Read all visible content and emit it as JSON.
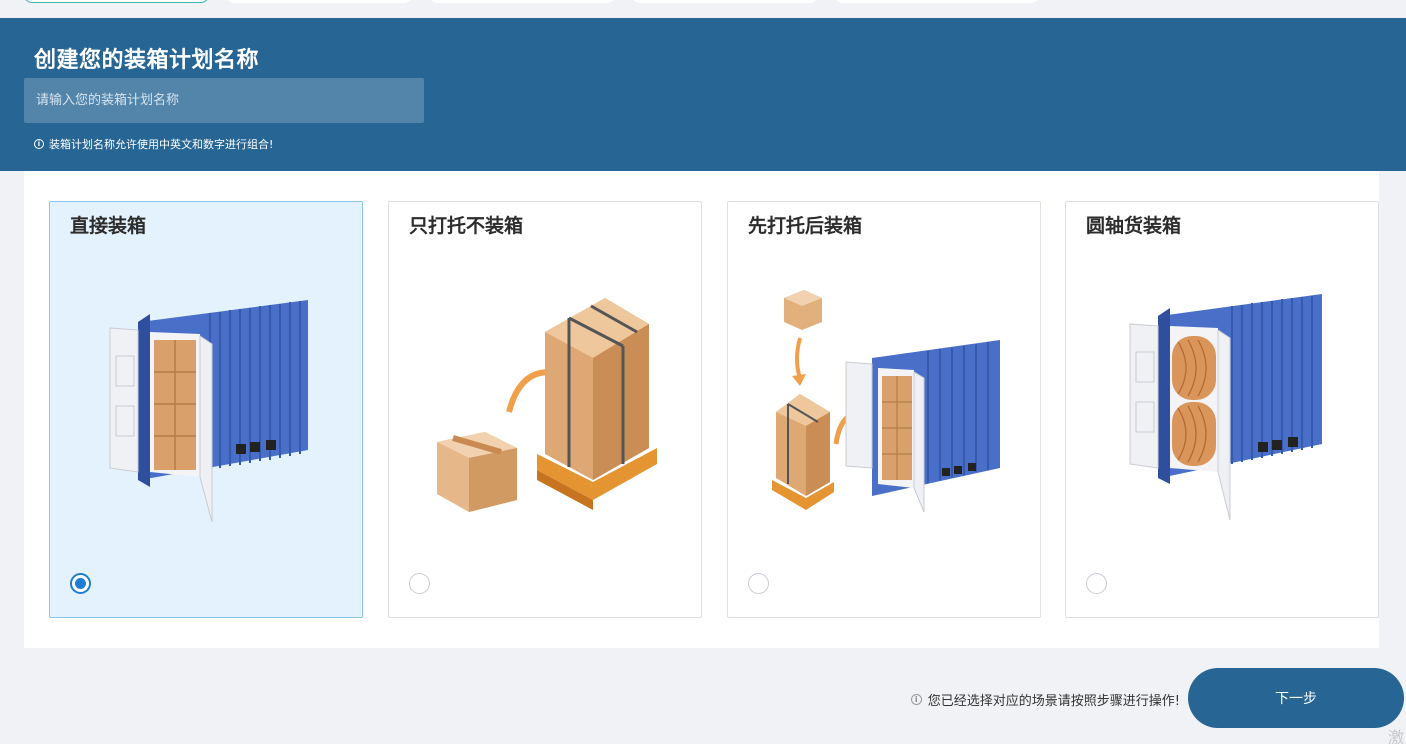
{
  "header": {
    "title": "创建您的装箱计划名称",
    "input_placeholder": "请输入您的装箱计划名称",
    "input_value": "",
    "hint": "装箱计划名称允许使用中英文和数字进行组合!"
  },
  "scenarios": [
    {
      "title": "直接装箱",
      "selected": true,
      "icon": "container-with-boxes-illustration"
    },
    {
      "title": "只打托不装箱",
      "selected": false,
      "icon": "pallet-boxes-illustration"
    },
    {
      "title": "先打托后装箱",
      "selected": false,
      "icon": "pallet-into-container-illustration"
    },
    {
      "title": "圆轴货装箱",
      "selected": false,
      "icon": "container-with-rolls-illustration"
    }
  ],
  "footer": {
    "note": "您已经选择对应的场景请按照步骤进行操作!",
    "next_label": "下一步",
    "corner_text": "激"
  },
  "colors": {
    "header_bg": "#266594",
    "selected_card_bg": "#e4f2fd",
    "radio_accent": "#1e7dd2",
    "container_blue": "#3f64bf",
    "box_tan": "#d9a06b",
    "arrow_orange": "#f0a04a"
  }
}
